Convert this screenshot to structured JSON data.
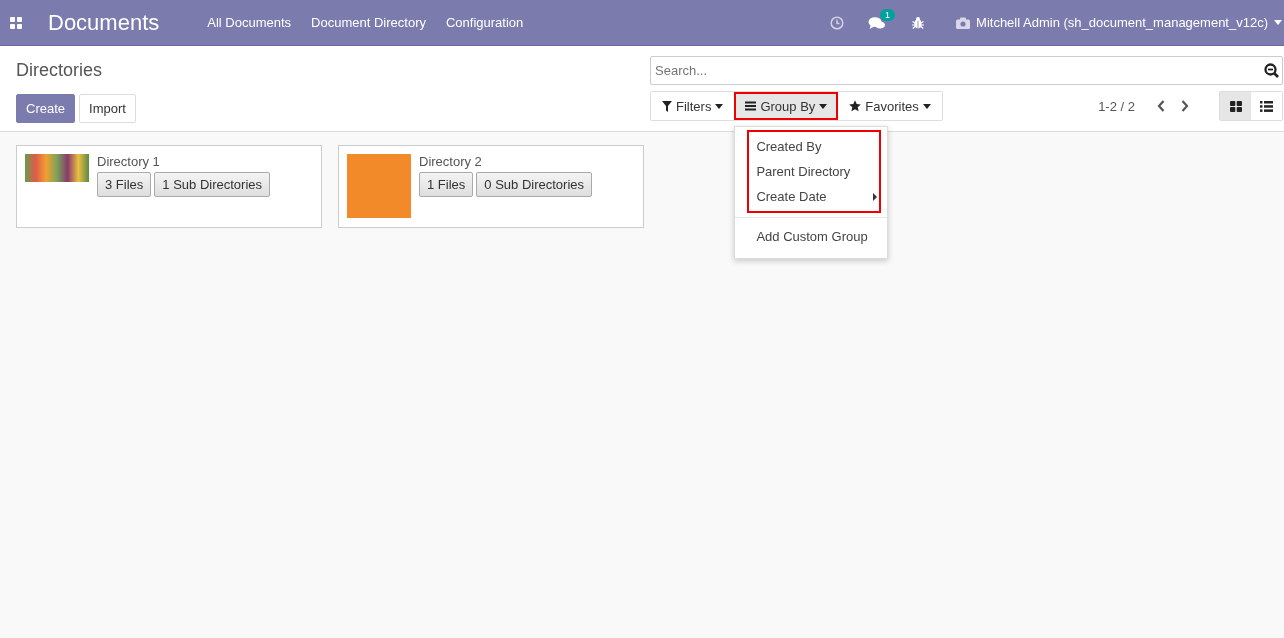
{
  "navbar": {
    "app_title": "Documents",
    "menu": [
      "All Documents",
      "Document Directory",
      "Configuration"
    ],
    "message_count": "1",
    "user": "Mitchell Admin (sh_document_management_v12c)"
  },
  "control_panel": {
    "breadcrumb": "Directories",
    "buttons": [
      {
        "label": "Create",
        "kind": "primary"
      },
      {
        "label": "Import",
        "kind": "secondary"
      }
    ],
    "search": {
      "placeholder": "Search..."
    },
    "search_options": [
      {
        "label": "Filters",
        "kind": "filter",
        "open": false,
        "highlighted": false
      },
      {
        "label": "Group By",
        "kind": "group",
        "open": true,
        "highlighted": true
      },
      {
        "label": "Favorites",
        "kind": "star",
        "open": false,
        "highlighted": false
      }
    ],
    "pager": "1-2 / 2",
    "views": [
      {
        "kind": "kanban",
        "selected": true
      },
      {
        "kind": "list",
        "selected": false
      }
    ]
  },
  "group_by_menu": {
    "highlighted_items": [
      {
        "label": "Created By",
        "submenu": false
      },
      {
        "label": "Parent Directory",
        "submenu": false
      },
      {
        "label": "Create Date",
        "submenu": true
      }
    ],
    "items": [
      {
        "label": "Add Custom Group",
        "submenu": false
      }
    ]
  },
  "cards": [
    {
      "name": "Directory 1",
      "kind": "photo",
      "buttons": [
        "3 Files",
        "1 Sub Directories"
      ]
    },
    {
      "name": "Directory 2",
      "kind": "avatar",
      "buttons": [
        "1 Files",
        "0 Sub Directories"
      ]
    }
  ]
}
